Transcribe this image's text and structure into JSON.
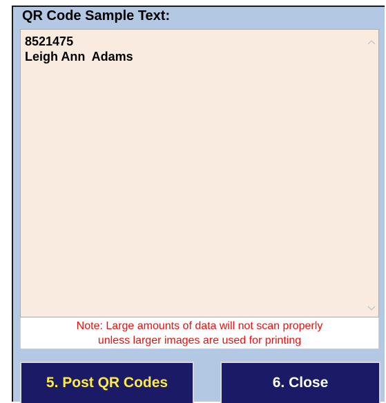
{
  "group": {
    "label": "QR Code Sample Text:"
  },
  "textarea": {
    "value": "8521475\nLeigh Ann  Adams"
  },
  "note": {
    "line1": "Note: Large amounts of data will not scan properly",
    "line2": "unless larger images are used for printing"
  },
  "buttons": {
    "post_label": "5. Post QR Codes",
    "close_label": "6. Close"
  },
  "colors": {
    "panel_bg": "#b3c8e2",
    "textarea_bg": "#f9ebdf",
    "note_text": "#e8100f",
    "button_bg": "#1a1a66",
    "post_text": "#ffeb3b",
    "close_text": "#ffffff"
  },
  "icons": {
    "scroll_up": "chevron-up-icon",
    "scroll_down": "chevron-down-icon"
  }
}
